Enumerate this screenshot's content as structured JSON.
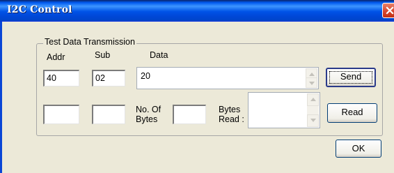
{
  "window": {
    "title": "I2C Control"
  },
  "group": {
    "title": "Test Data Transmission"
  },
  "labels": {
    "addr": "Addr",
    "sub": "Sub",
    "data": "Data",
    "no_of_bytes_line1": "No. Of",
    "no_of_bytes_line2": "Bytes",
    "bytes_read_line1": "Bytes",
    "bytes_read_line2": "Read :"
  },
  "fields": {
    "addr": "40",
    "sub": "02",
    "data": "20",
    "read_addr": "",
    "read_sub": "",
    "no_of_bytes": "",
    "bytes_read": ""
  },
  "buttons": {
    "send": "Send",
    "read": "Read",
    "ok": "OK"
  },
  "icons": {
    "close": "close-icon",
    "scroll_up": "arrow-up-icon",
    "scroll_down": "arrow-down-icon"
  }
}
